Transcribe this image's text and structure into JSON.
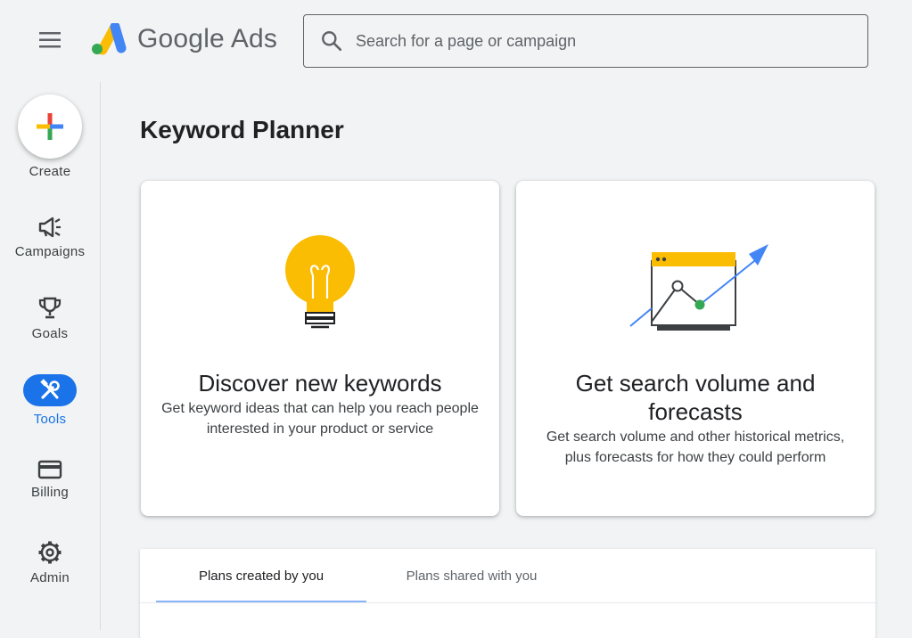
{
  "header": {
    "app_name": "Google Ads",
    "search_placeholder": "Search for a page or campaign"
  },
  "sidebar": {
    "items": [
      {
        "label": "Create",
        "icon": "plus-icon"
      },
      {
        "label": "Campaigns",
        "icon": "megaphone-icon"
      },
      {
        "label": "Goals",
        "icon": "trophy-icon"
      },
      {
        "label": "Tools",
        "icon": "tools-icon",
        "active": true
      },
      {
        "label": "Billing",
        "icon": "credit-card-icon"
      },
      {
        "label": "Admin",
        "icon": "gear-icon"
      }
    ]
  },
  "main": {
    "title": "Keyword Planner",
    "cards": [
      {
        "title": "Discover new keywords",
        "description": "Get keyword ideas that can help you reach people interested in your product or service",
        "icon": "lightbulb-icon"
      },
      {
        "title": "Get search volume and forecasts",
        "description": "Get search volume and other historical metrics, plus forecasts for how they could perform",
        "icon": "forecast-chart-icon"
      }
    ],
    "plans_tabs": [
      {
        "label": "Plans created by you",
        "active": true
      },
      {
        "label": "Plans shared with you",
        "active": false
      }
    ]
  },
  "colors": {
    "accent": "#1a73e8",
    "background": "#f1f3f4",
    "yellow": "#fbbc04",
    "green": "#34a853",
    "red": "#ea4335"
  }
}
